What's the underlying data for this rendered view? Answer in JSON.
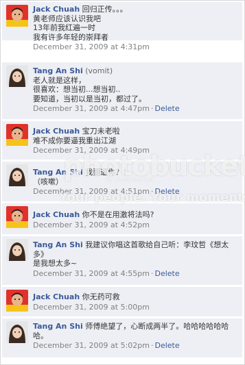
{
  "comments": [
    {
      "name": "Jack Chuah",
      "inline_text": "回归正传。。。",
      "lines": [
        "黄老师应该认识我吧",
        "13年前我红遍一时",
        "我有许多年轻的崇拜者"
      ],
      "timestamp": "December 31, 2009 at 4:31pm",
      "delete": ""
    },
    {
      "name": "Tang An Shi",
      "extra": "(vomit)",
      "inline_text": "",
      "lines": [
        "老人就是这样，",
        "很喜欢：想当初...想当初..",
        "要知道，当初以是当初，都过了。"
      ],
      "timestamp": "December 31, 2009 at 4:47pm",
      "delete": "Delete"
    },
    {
      "name": "Jack Chuah",
      "inline_text": "宝刀未老啦",
      "lines": [
        "难不成你要逼我重出江湖"
      ],
      "timestamp": "December 31, 2009 at 4:49pm",
      "delete": ""
    },
    {
      "name": "Tang An Shi",
      "inline_text": "我要逼你？！",
      "lines": [
        "（咳嗽）"
      ],
      "timestamp": "December 31, 2009 at 4:51pm",
      "delete": "Delete"
    },
    {
      "name": "Jack Chuah",
      "inline_text": "你不是在用激将法吗?",
      "lines": [],
      "timestamp": "December 31, 2009 at 4:52pm",
      "delete": ""
    },
    {
      "name": "Tang An Shi",
      "inline_text": "我建议你唱这首歌给自己听：李玟哲《想太",
      "lines": [
        "多》",
        "是我想太多~"
      ],
      "timestamp": "December 31, 2009 at 4:55pm",
      "delete": "Delete"
    },
    {
      "name": "Jack Chuah",
      "inline_text": "你无药可救",
      "lines": [],
      "timestamp": "December 31, 2009 at 5:00pm",
      "delete": ""
    },
    {
      "name": "Tang An Shi",
      "inline_text": "师傅绝望了，心断成两半了。哈哈哈哈哈哈",
      "lines": [
        "哈。"
      ],
      "timestamp": "December 31, 2009 at 5:02pm",
      "delete": "Delete"
    }
  ],
  "watermark": {
    "logo": "photobucket",
    "sub": "by photobucket",
    "tagline": "Your people. Your moments."
  },
  "colors": {
    "name_link": "#3b5998",
    "comment_bg": "#edeff4",
    "timestamp": "#808080"
  }
}
